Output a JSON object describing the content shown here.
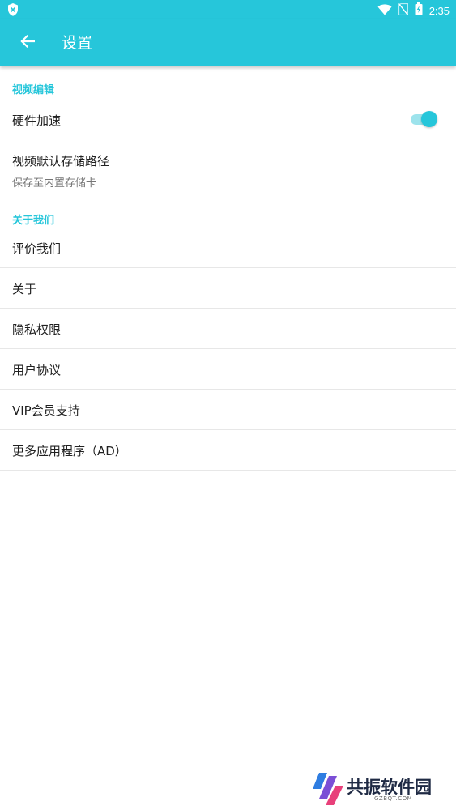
{
  "status_bar": {
    "time": "2:35",
    "icons": [
      "shield-icon",
      "wifi-icon",
      "no-sim-icon",
      "battery-charging-icon"
    ]
  },
  "app_bar": {
    "title": "设置",
    "back_icon": "arrow-left-icon"
  },
  "sections": {
    "video_edit": {
      "header": "视频编辑",
      "hardware_accel": {
        "label": "硬件加速",
        "enabled": true
      },
      "storage_path": {
        "label": "视频默认存储路径",
        "sub": "保存至内置存储卡"
      }
    },
    "about_us": {
      "header": "关于我们",
      "items": [
        {
          "label": "评价我们"
        },
        {
          "label": "关于"
        },
        {
          "label": "隐私权限"
        },
        {
          "label": "用户协议"
        },
        {
          "label": "VIP会员支持"
        },
        {
          "label": "更多应用程序（AD）"
        }
      ]
    }
  },
  "watermark": {
    "text": "共振软件园",
    "sub": "GZBQT.COM"
  },
  "colors": {
    "accent": "#26c6da",
    "toggle_track": "#9de3ec",
    "text_primary": "#212121",
    "text_secondary": "#757575"
  }
}
